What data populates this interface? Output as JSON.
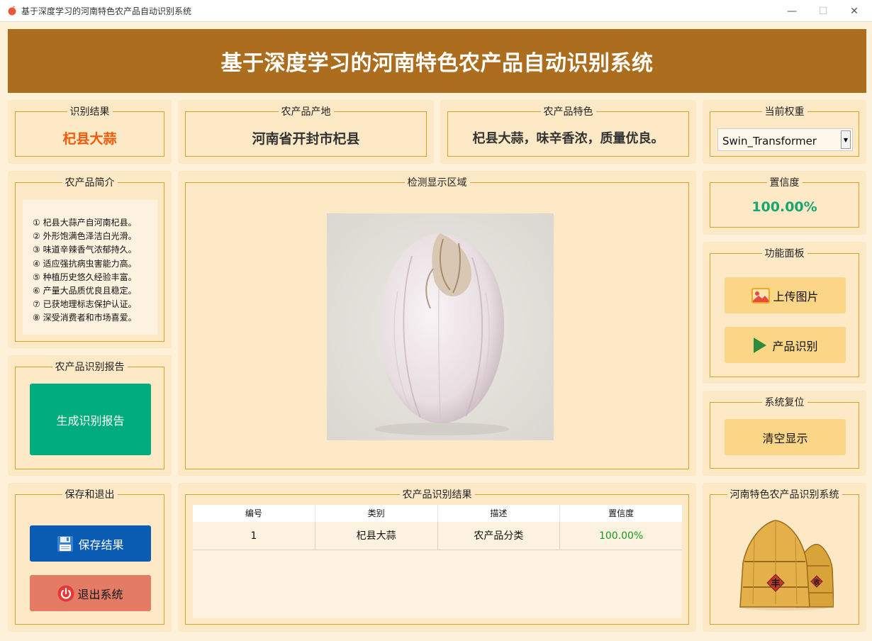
{
  "window": {
    "title": "基于深度学习的河南特色农产品自动识别系统",
    "minimize_glyph": "—",
    "maximize_glyph": "☐",
    "close_glyph": "✕"
  },
  "header": {
    "title": "基于深度学习的河南特色农产品自动识别系统"
  },
  "result": {
    "label": "识别结果",
    "value": "杞县大蒜"
  },
  "origin": {
    "label": "农产品产地",
    "value": "河南省开封市杞县"
  },
  "feature": {
    "label": "农产品特色",
    "value": "杞县大蒜，味辛香浓，质量优良。"
  },
  "weight": {
    "label": "当前权重",
    "selected": "Swin_Transformer"
  },
  "intro": {
    "label": "农产品简介",
    "items": [
      "① 杞县大蒜产自河南杞县。",
      "② 外形饱满色泽洁白光滑。",
      "③ 味道辛辣香气浓郁持久。",
      "④ 适应强抗病虫害能力高。",
      "⑤ 种植历史悠久经验丰富。",
      "⑥ 产量大品质优良且稳定。",
      "⑦ 已获地理标志保护认证。",
      "⑧ 深受消费者和市场喜爱。"
    ]
  },
  "detect": {
    "label": "检测显示区域"
  },
  "confidence": {
    "label": "置信度",
    "value": "100.00%"
  },
  "functions": {
    "label": "功能面板",
    "upload": "上传图片",
    "recognize": "产品识别"
  },
  "reset": {
    "label": "系统复位",
    "clear": "清空显示"
  },
  "report": {
    "label": "农产品识别报告",
    "generate": "生成识别报告"
  },
  "save_exit": {
    "label": "保存和退出",
    "save": "保存结果",
    "exit": "退出系统"
  },
  "results_table": {
    "label": "农产品识别结果",
    "headers": [
      "编号",
      "类别",
      "描述",
      "置信度"
    ],
    "rows": [
      [
        "1",
        "杞县大蒜",
        "农产品分类",
        "100.00%"
      ]
    ]
  },
  "logo_panel": {
    "label": "河南特色农产品识别系统",
    "logo_char_left": "丰",
    "logo_char_right": "收"
  },
  "colors": {
    "header_bg": "#ad6d1f",
    "result_text": "#f15a0b",
    "confidence_text": "#17a673",
    "table_conf_text": "#1a9a1a",
    "report_btn": "#00ab7e",
    "save_btn": "#0a5cb3",
    "exit_btn": "#e37b65",
    "func_btn": "#fbd686"
  }
}
